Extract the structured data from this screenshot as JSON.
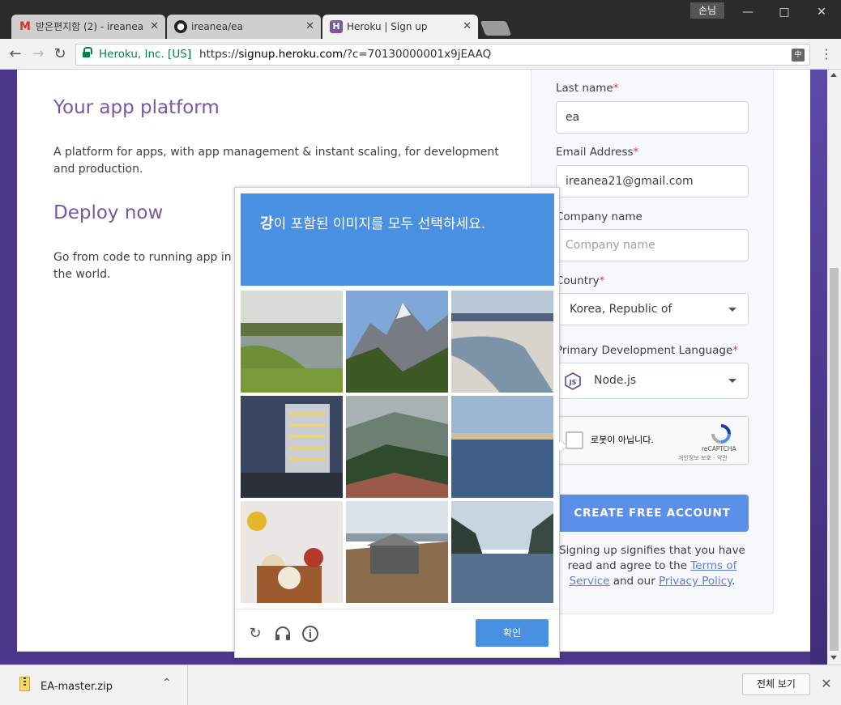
{
  "browser": {
    "guest_label": "손님",
    "tabs": [
      {
        "title": "받은편지함 (2) - ireanea",
        "icon": "gmail-icon"
      },
      {
        "title": "ireanea/ea",
        "icon": "github-icon"
      },
      {
        "title": "Heroku | Sign up",
        "icon": "heroku-icon"
      }
    ],
    "security_label": "Heroku, Inc. [US]",
    "url_scheme": "https://",
    "url_host": "signup.heroku.com",
    "url_path": "/?c=70130000001x9jEAAQ"
  },
  "page": {
    "platform_heading": "Your app platform",
    "platform_text": "A platform for apps, with app management & instant scaling, for development and production.",
    "deploy_heading": "Deploy now",
    "deploy_text": "Go from code to running app in minutes. Deploy, scale, and deliver your app to the world."
  },
  "form": {
    "last_name_label": "Last name",
    "last_name_value": "ea",
    "email_label": "Email Address",
    "email_value": "ireanea21@gmail.com",
    "company_label": "Company name",
    "company_placeholder": "Company name",
    "country_label": "Country",
    "country_value": "Korea, Republic of",
    "language_label": "Primary Development Language",
    "language_value": "Node.js",
    "required_mark": "*",
    "recaptcha_label": "로봇이 아닙니다.",
    "recaptcha_brand": "reCAPTCHA",
    "recaptcha_links": "개인정보 보호 - 약관",
    "create_button": "CREATE FREE ACCOUNT",
    "terms_prefix": "Signing up signifies that you have read and agree to the ",
    "terms_link": "Terms of Service",
    "terms_middle": " and our ",
    "privacy_link": "Privacy Policy",
    "terms_suffix": "."
  },
  "challenge": {
    "keyword": "강",
    "instruction": "이 포함된 이미지를 모두 선택하세요.",
    "verify_label": "확인",
    "tiles": [
      "lake-meadow",
      "mountain-valley",
      "frozen-river",
      "hotel-building",
      "forest-hills",
      "harbor-water",
      "food-table",
      "hill-hut",
      "sea-cove"
    ]
  },
  "downloads": {
    "file_name": "EA-master.zip",
    "show_all": "전체 보기"
  },
  "colors": {
    "heroku_purple": "#79589f",
    "button_blue": "#5c8fea",
    "captcha_blue": "#4a90e2"
  }
}
